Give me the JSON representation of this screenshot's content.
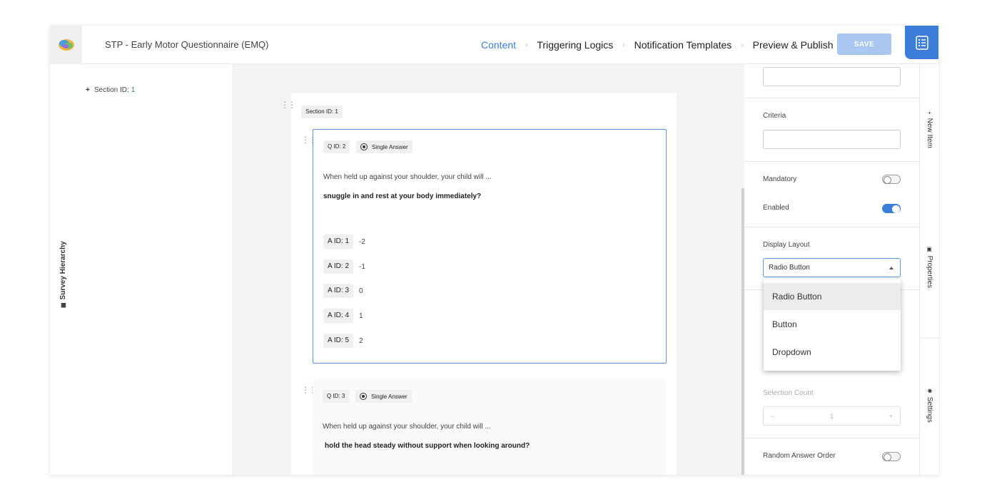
{
  "header": {
    "title": "STP - Early Motor Questionnaire (EMQ)",
    "nav": [
      "Content",
      "Triggering Logics",
      "Notification Templates",
      "Preview & Publish"
    ],
    "save_label": "SAVE"
  },
  "hierarchy": {
    "label": "Survey Hierarchy",
    "item_prefix": "Section ID:",
    "item_num": "1"
  },
  "section_chip": "Section ID: 1",
  "questions": [
    {
      "id_label": "Q ID: 2",
      "type": "Single Answer",
      "prompt": "When held up against your shoulder, your child will ...",
      "text": "snuggle in and rest at your body immediately?",
      "answers": [
        {
          "id": "A ID: 1",
          "value": "-2"
        },
        {
          "id": "A ID: 2",
          "value": "-1"
        },
        {
          "id": "A ID: 3",
          "value": "0"
        },
        {
          "id": "A ID: 4",
          "value": "1"
        },
        {
          "id": "A ID: 5",
          "value": "2"
        }
      ]
    },
    {
      "id_label": "Q ID: 3",
      "type": "Single Answer",
      "prompt": "When held up against your shoulder, your child will ...",
      "text": "hold the head steady without support when looking around?"
    }
  ],
  "properties": {
    "criteria_label": "Criteria",
    "mandatory_label": "Mandatory",
    "enabled_label": "Enabled",
    "display_layout_label": "Display Layout",
    "display_layout_value": "Radio Button",
    "layout_options": [
      "Radio Button",
      "Button",
      "Dropdown"
    ],
    "selection_count_label": "Selection Count",
    "selection_count_minus": "−",
    "selection_count_value": "1",
    "selection_count_plus": "+",
    "random_order_label": "Random Answer Order"
  },
  "tabs": {
    "new_item": "New Item",
    "properties": "Properties",
    "settings": "Settings"
  },
  "colors": {
    "accent": "#3b7dd8",
    "save_disabled": "#a9c7f0"
  }
}
